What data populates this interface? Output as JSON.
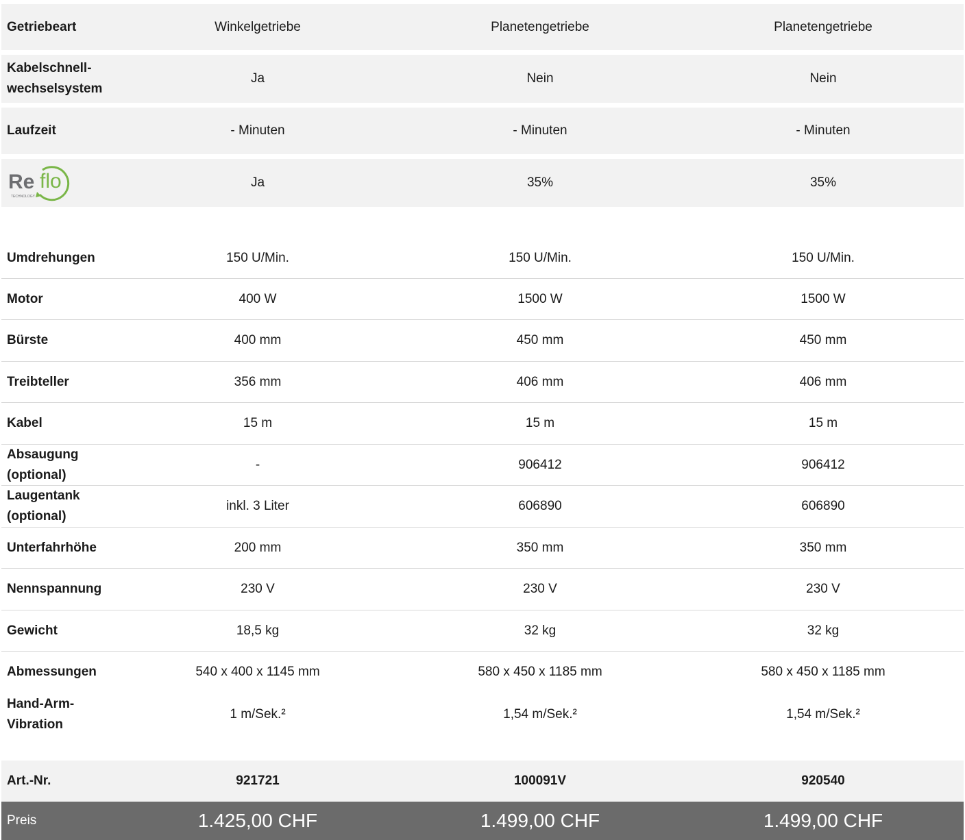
{
  "top_rows": [
    {
      "label": "Getriebeart",
      "v1": "Winkelgetriebe",
      "v2": "Planetengetriebe",
      "v3": "Planetengetriebe"
    },
    {
      "label": "Kabelschnell-wechselsystem",
      "v1": "Ja",
      "v2": "Nein",
      "v3": "Nein"
    },
    {
      "label": "Laufzeit",
      "v1": "- Minuten",
      "v2": "- Minuten",
      "v3": "- Minuten"
    }
  ],
  "reflo": {
    "logo_text": "Re",
    "logo_text2": "flo",
    "logo_sub": "TECHNOLOGY",
    "v1": "Ja",
    "v2": "35%",
    "v3": "35%"
  },
  "specs": [
    {
      "label": "Umdrehungen",
      "v1": "150 U/Min.",
      "v2": "150 U/Min.",
      "v3": "150 U/Min."
    },
    {
      "label": "Motor",
      "v1": "400 W",
      "v2": "1500 W",
      "v3": "1500 W"
    },
    {
      "label": "Bürste",
      "v1": "400 mm",
      "v2": "450 mm",
      "v3": "450 mm"
    },
    {
      "label": "Treibteller",
      "v1": "356 mm",
      "v2": "406 mm",
      "v3": "406 mm"
    },
    {
      "label": "Kabel",
      "v1": "15 m",
      "v2": "15 m",
      "v3": "15 m"
    },
    {
      "label": "Absaugung (optional)",
      "v1": "-",
      "v2": "906412",
      "v3": "906412"
    },
    {
      "label": "Laugentank (optional)",
      "v1": "inkl. 3 Liter",
      "v2": "606890",
      "v3": "606890"
    },
    {
      "label": "Unterfahrhöhe",
      "v1": "200 mm",
      "v2": "350 mm",
      "v3": "350 mm"
    },
    {
      "label": "Nennspannung",
      "v1": "230 V",
      "v2": "230 V",
      "v3": "230 V"
    },
    {
      "label": "Gewicht",
      "v1": "18,5 kg",
      "v2": "32 kg",
      "v3": "32 kg"
    },
    {
      "label": "Abmessungen",
      "v1": "540 x 400 x 1145 mm",
      "v2": "580 x 450 x 1185 mm",
      "v3": "580 x 450 x 1185 mm"
    },
    {
      "label": "Hand-Arm-Vibration",
      "v1": "1 m/Sek.²",
      "v2": "1,54 m/Sek.²",
      "v3": "1,54 m/Sek.²"
    }
  ],
  "article": {
    "label": "Art.-Nr.",
    "v1": "921721",
    "v2": "100091V",
    "v3": "920540"
  },
  "price": {
    "label": "Preis",
    "v1": "1.425,00 CHF",
    "v2": "1.499,00 CHF",
    "v3": "1.499,00 CHF"
  },
  "colors": {
    "row_bg": "#f2f2f2",
    "price_bg": "#6b6b6b",
    "logo_gray": "#6d6e71",
    "logo_green": "#7ab648"
  }
}
